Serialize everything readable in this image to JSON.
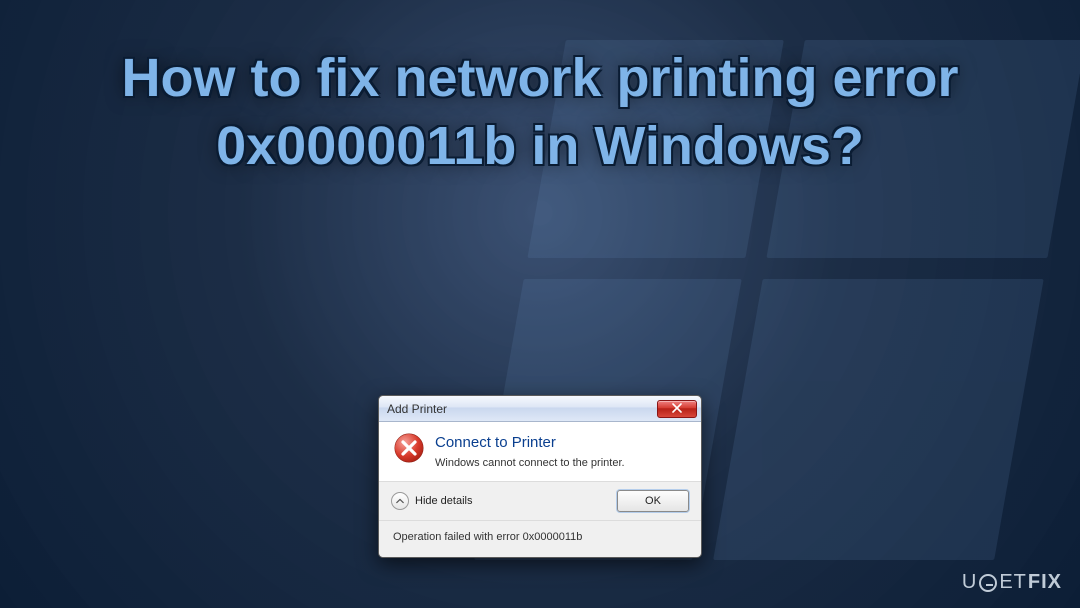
{
  "headline": "How to fix network printing error 0x0000011b in Windows?",
  "dialog": {
    "title": "Add Printer",
    "heading": "Connect to Printer",
    "message": "Windows cannot connect to the printer.",
    "hide_details_label": "Hide details",
    "ok_label": "OK",
    "details": "Operation failed with error 0x0000011b"
  },
  "watermark": {
    "prefix": "U",
    "middle": "ET",
    "suffix": "FIX"
  },
  "colors": {
    "headline": "#7fb4e8",
    "link": "#0a3f8f",
    "close": "#c62f24"
  }
}
